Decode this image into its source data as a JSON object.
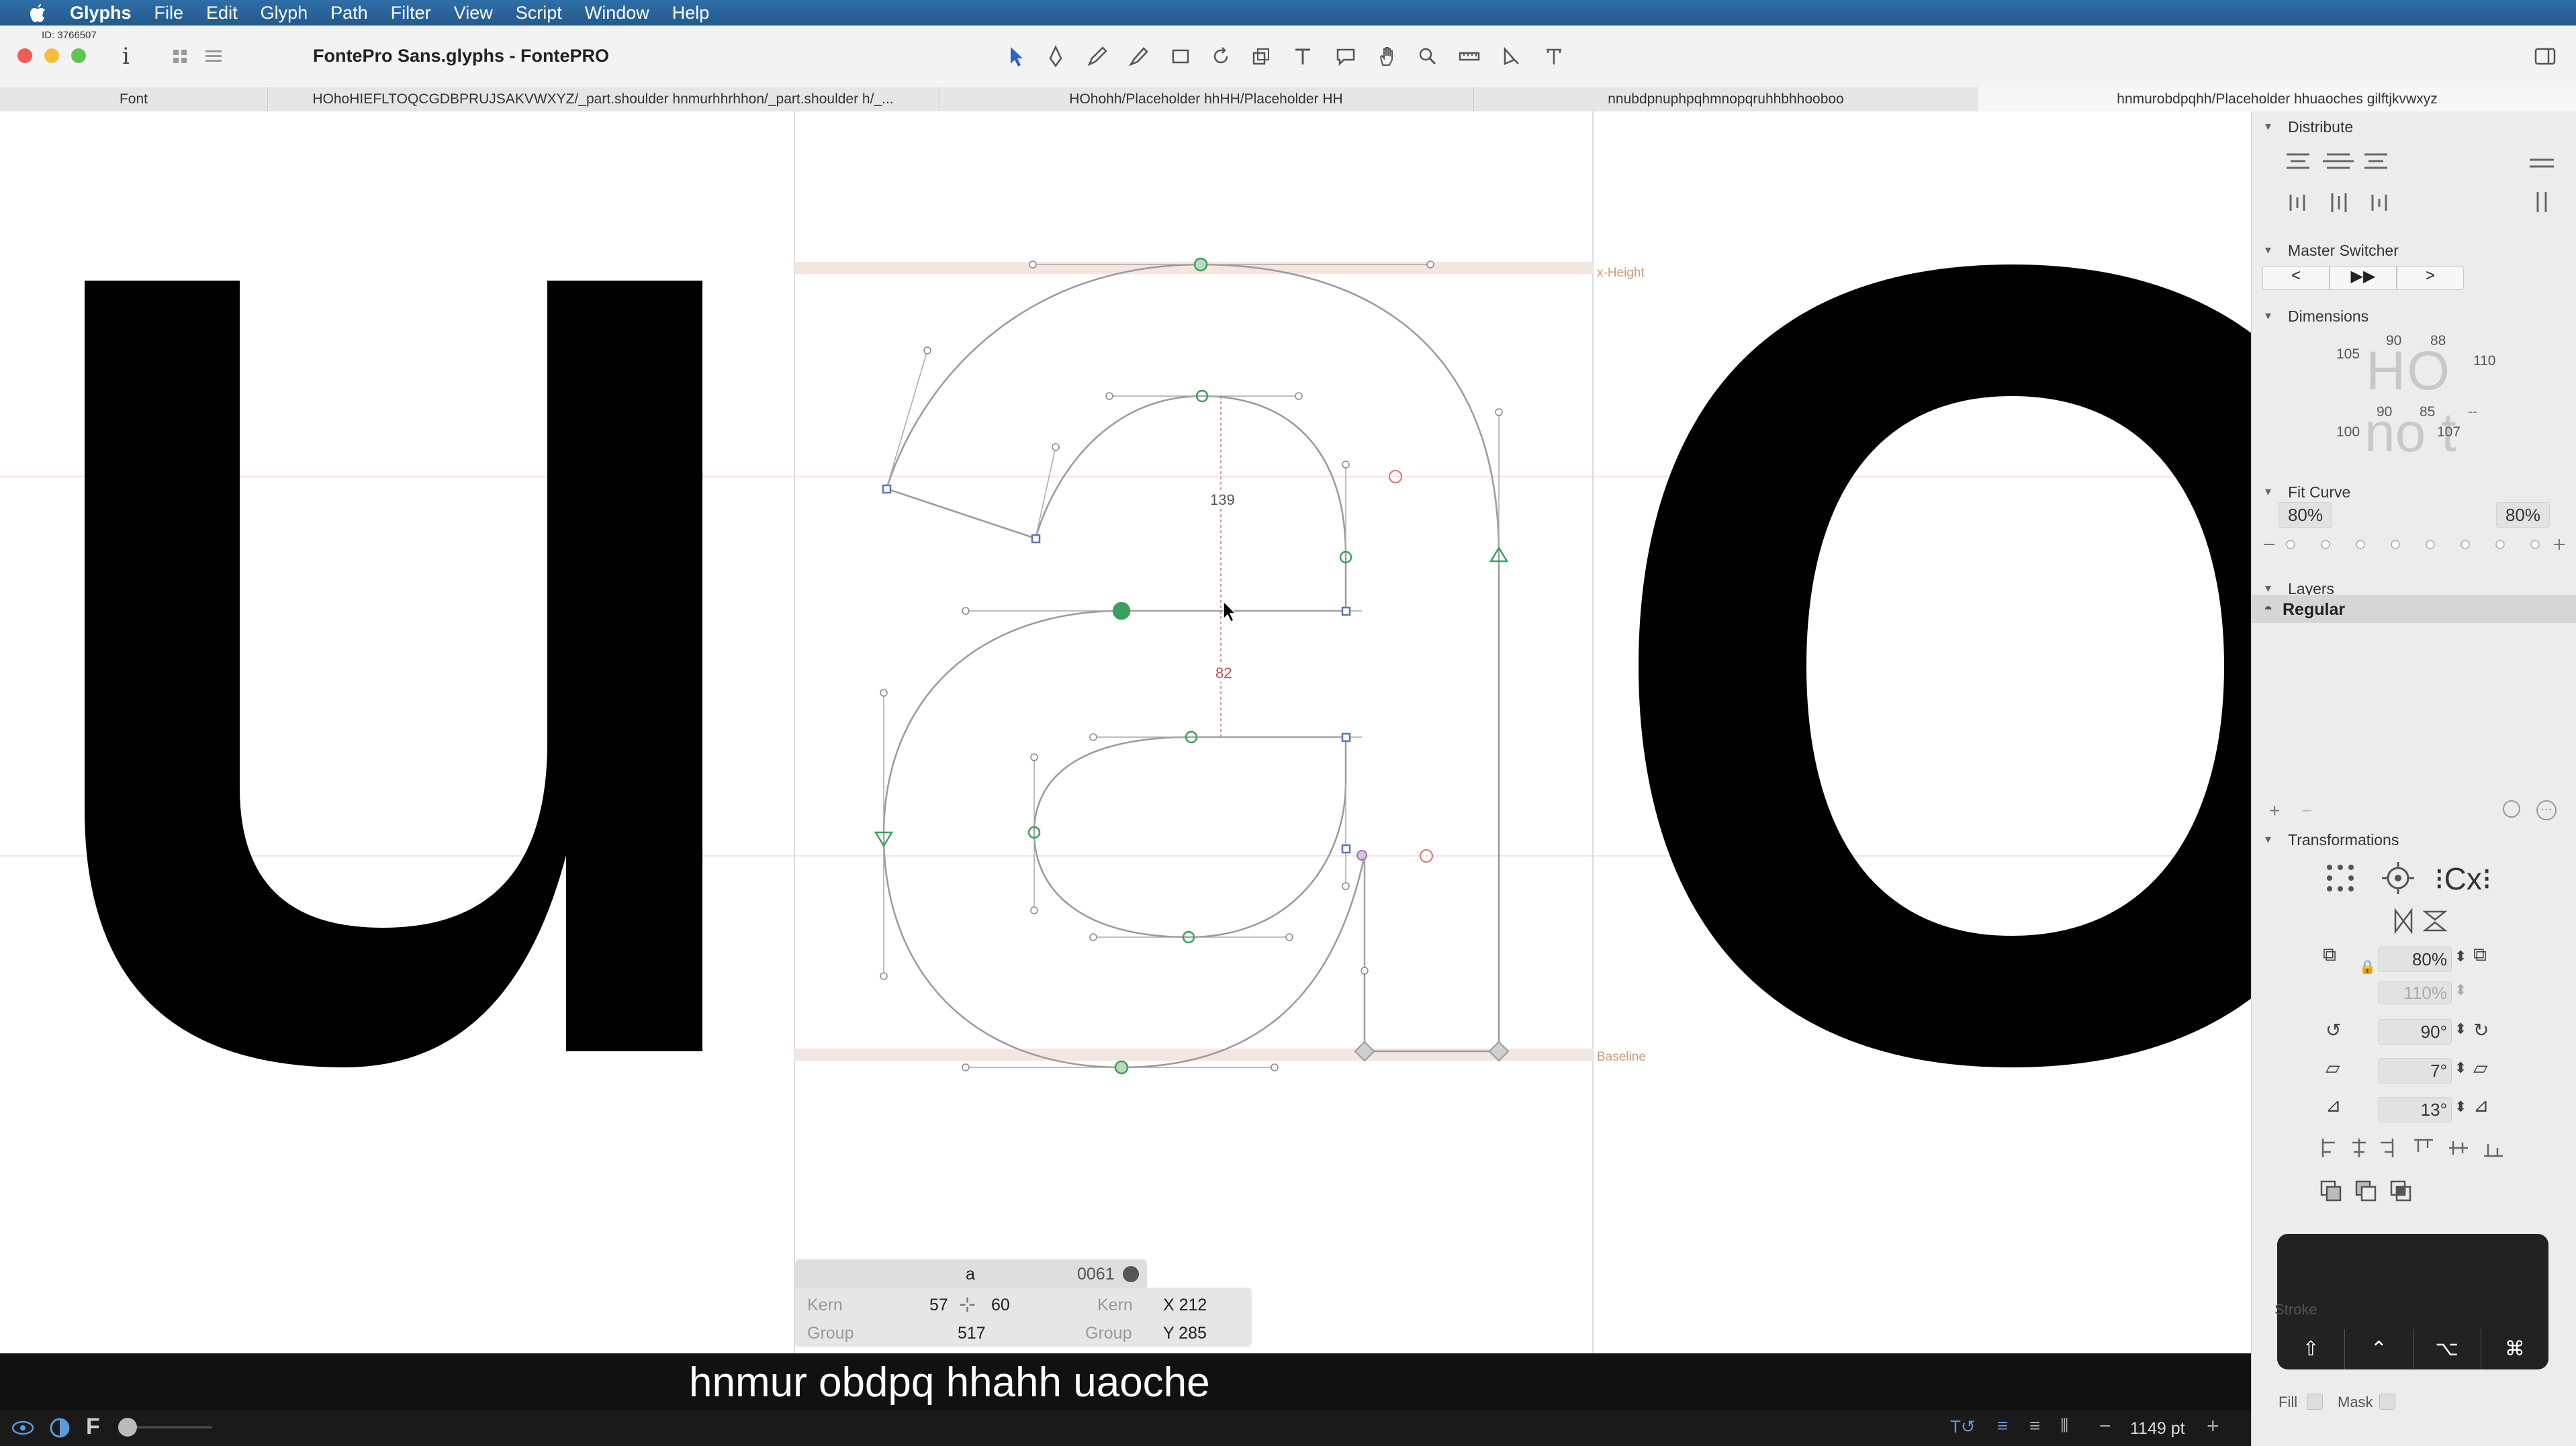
{
  "menubar": {
    "app_name": "Glyphs",
    "items": [
      "File",
      "Edit",
      "Glyph",
      "Path",
      "Filter",
      "View",
      "Script",
      "Window",
      "Help"
    ]
  },
  "window": {
    "id_label": "ID: 3766507",
    "title": "FontePro Sans.glyphs - FontePRO"
  },
  "tabs": [
    {
      "label": "Font"
    },
    {
      "label": "HOhoHIEFLTOQCGDBPRUJSAKVWXYZ/_part.shoulder hnmurhhrhhon/_part.shoulder h/_..."
    },
    {
      "label": "HOhohh/Placeholder hhHH/Placeholder HH"
    },
    {
      "label": "nnubdpnuphpqhmnopqruhhbhhooboo"
    },
    {
      "label": "hnmurobdpqhh/Placeholder hhuaoches gilftjkvwxyz"
    }
  ],
  "canvas": {
    "metrics": {
      "x_height": "x-Height",
      "baseline": "Baseline"
    },
    "measure_top": "139",
    "measure_bottom": "82"
  },
  "info_box": {
    "glyph_name": "a",
    "unicode": "0061",
    "kern_label": "Kern",
    "group_label": "Group",
    "lsb": "57",
    "rsb": "60",
    "width": "517",
    "x": "X 212",
    "y": "Y 285"
  },
  "preview": {
    "text": "hnmur obdpq hhahh uaoche"
  },
  "status": {
    "zoom": "1149 pt",
    "mode_letter": "F"
  },
  "sidebar": {
    "distribute": {
      "title": "Distribute"
    },
    "master_switcher": {
      "title": "Master Switcher"
    },
    "dimensions": {
      "title": "Dimensions",
      "glyphs_top": "HO",
      "glyphs_bottom": "no t",
      "v1": "105",
      "v2": "90",
      "v3": "88",
      "v4": "110",
      "v5": "100",
      "v6": "90",
      "v7": "85",
      "v8": "107",
      "v9": "--"
    },
    "fit_curve": {
      "title": "Fit Curve",
      "left": "80%",
      "right": "80%"
    },
    "layers": {
      "title": "Layers",
      "items": [
        {
          "name": "Regular"
        }
      ]
    },
    "transformations": {
      "title": "Transformations",
      "scale": "80%",
      "scale2": "110%",
      "rotate": "90°",
      "slant": "7°",
      "skew": "13°",
      "cx": "Cx"
    },
    "stroke": {
      "label": "Stroke",
      "fill": "Fill",
      "mask": "Mask"
    }
  },
  "colors": {
    "menubar": "#2a64a0",
    "accent": "#2a64a0",
    "node_green": "#3aa05a",
    "metric_band": "#f3e6df"
  }
}
